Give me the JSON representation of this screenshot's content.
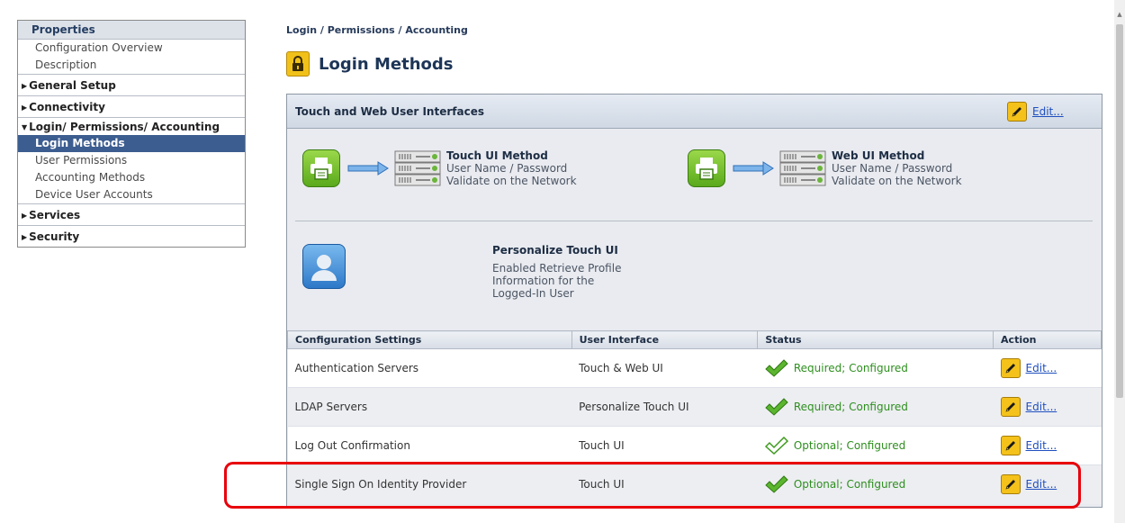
{
  "sidebar": {
    "properties_label": "Properties",
    "top_items": [
      "Configuration Overview",
      "Description"
    ],
    "sections": {
      "general": "General Setup",
      "connectivity": "Connectivity",
      "login": "Login/ Permissions/ Accounting",
      "services": "Services",
      "security": "Security"
    },
    "login_items": [
      "Login Methods",
      "User Permissions",
      "Accounting Methods",
      "Device User Accounts"
    ],
    "active_item": "Login Methods"
  },
  "breadcrumb": "Login / Permissions / Accounting",
  "page_title": "Login Methods",
  "panel": {
    "title": "Touch and Web User Interfaces",
    "edit_label": "Edit...",
    "touch_method": {
      "title": "Touch UI Method",
      "line1": "User Name / Password",
      "line2": "Validate on the Network"
    },
    "web_method": {
      "title": "Web UI Method",
      "line1": "User Name / Password",
      "line2": "Validate on the Network"
    },
    "personalize": {
      "title": "Personalize Touch UI",
      "line1": "Enabled Retrieve Profile",
      "line2": "Information for the",
      "line3": "Logged-In User"
    }
  },
  "table": {
    "headers": [
      "Configuration Settings",
      "User Interface",
      "Status",
      "Action"
    ],
    "rows": [
      {
        "setting": "Authentication Servers",
        "ui": "Touch & Web UI",
        "status": "Required; Configured",
        "check": "solid",
        "action": "Edit..."
      },
      {
        "setting": "LDAP Servers",
        "ui": "Personalize Touch UI",
        "status": "Required; Configured",
        "check": "solid",
        "action": "Edit..."
      },
      {
        "setting": "Log Out Confirmation",
        "ui": "Touch UI",
        "status": "Optional; Configured",
        "check": "outline",
        "action": "Edit..."
      },
      {
        "setting": "Single Sign On Identity Provider",
        "ui": "Touch UI",
        "status": "Optional; Configured",
        "check": "solid",
        "action": "Edit..."
      }
    ]
  },
  "colors": {
    "highlight": "#e8000b",
    "status_text": "#2e8f1f",
    "active_nav": "#3c5d90",
    "link": "#1f4fbf"
  },
  "icons": [
    "lock-icon",
    "pencil-icon",
    "printer-icon",
    "arrow-right-icon",
    "server-icon",
    "user-profile-icon",
    "check-icon"
  ]
}
